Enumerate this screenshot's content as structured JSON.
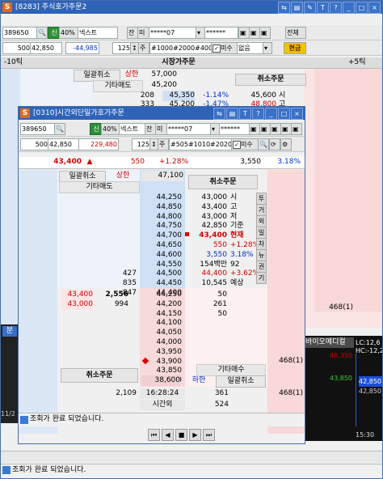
{
  "back_window": {
    "title": "[8283] 주식호가주문2",
    "toolbar": {
      "code": "389650",
      "btn_sin": "신",
      "pct": "40%",
      "name": "넥스트",
      "btn_jan": "잔",
      "btn_mi": "미",
      "account": "*****07",
      "password": "******",
      "btn_all": "전체",
      "btn_cash": "현금"
    },
    "row2": {
      "price": "500",
      "current": "42,850",
      "change": "-44,985",
      "qty": "125",
      "btn_ju": "주",
      "lots": "#1000#2000#4000",
      "misu": "미수",
      "credit": "없음"
    },
    "header": {
      "left": "-10틱",
      "mid": "시장가주문",
      "right": "+5틱"
    },
    "rows": {
      "cancel_all": "일괄취소",
      "upper": "상한",
      "upper_price": "57,000",
      "other_sell": "기타매도",
      "p1": "45,200",
      "cancel_order": "취소주문",
      "q1": "208",
      "p2": "45,350",
      "r1": "-1.14%",
      "m1": "45,600",
      "m1s": "시",
      "q2": "333",
      "p3": "45,200",
      "r2": "-1.47%",
      "m2": "48,800",
      "m2s": "고"
    },
    "right_side": {
      "qty_468": "468(1)",
      "stock_name": "바이오메디컬",
      "lc": "LC:12,6",
      "hc": "HC:-12,2",
      "v1": "48,350",
      "v2": "43,850",
      "v3": "42,850",
      "v4": "42,850",
      "time": "15:30",
      "status": "조회가 완료 되었습니다.",
      "tab_minute": "분",
      "date": "11/2"
    }
  },
  "front_window": {
    "title": "[0310]시간외단일가호가주문",
    "toolbar": {
      "code": "389650",
      "btn_sin": "신",
      "pct": "40%",
      "name": "넥스트",
      "btn_jan": "잔",
      "btn_mi": "미",
      "account": "*****07",
      "password": "******"
    },
    "row2": {
      "price": "500",
      "current": "42,850",
      "change": "229,480",
      "qty": "125",
      "btn_ju": "주",
      "lots": "#505#1010#2020",
      "misu": "미수"
    },
    "price_bar": {
      "price": "43,400",
      "arrow": "▲",
      "diff": "550",
      "rate": "+1.28%",
      "vol": "3,550",
      "vol_rate": "3.18%"
    },
    "header": {
      "cancel_all": "일괄취소",
      "upper": "상한",
      "upper_price": "47,100",
      "other_sell": "기타매도",
      "cancel_order": "취소주문"
    },
    "ask_prices": [
      "44,250",
      "44,850",
      "44,800",
      "44,750",
      "44,700",
      "44,650",
      "44,600",
      "44,550",
      "44,500",
      "44,450",
      "44,400"
    ],
    "ask_qty": [
      "",
      "",
      "",
      "",
      "",
      "",
      "",
      "",
      "427",
      "835",
      "847"
    ],
    "info_panel": [
      {
        "v": "43,000",
        "k": "시"
      },
      {
        "v": "43,400",
        "k": "고"
      },
      {
        "v": "43,000",
        "k": "저"
      },
      {
        "v": "42,850",
        "k": "기준"
      },
      {
        "v": "43,400",
        "k": "현재"
      },
      {
        "v": "550",
        "k": "+1.28%"
      },
      {
        "v": "3,550",
        "k": "3.18%"
      },
      {
        "v": "154백만",
        "k": "92"
      },
      {
        "v": "44,400",
        "k": "+3.62%"
      },
      {
        "v": "10,545",
        "k": "예상"
      }
    ],
    "vtabs": [
      "투",
      "거",
      "외",
      "일",
      "차",
      "뉴",
      "권",
      "기"
    ],
    "orders": [
      {
        "p": "43,400",
        "q": "2,556"
      },
      {
        "p": "43,000",
        "q": "994"
      }
    ],
    "bid_prices": [
      "44,250",
      "44,200",
      "44,150",
      "44,100",
      "44,050",
      "44,000",
      "43,950",
      "43,900",
      "43,850",
      "43,800"
    ],
    "bid_qty": [
      "50",
      "261",
      "50",
      "",
      "",
      "",
      "",
      "",
      "",
      ""
    ],
    "bid_total": "468(1)",
    "footer": {
      "lower_price": "38,600",
      "lower": "하한",
      "other_buy": "기타매수",
      "cancel_all2": "일괄취소",
      "cancel_order2": "취소주문",
      "total_sell": "2,109",
      "time": "16:28:24",
      "total_buy": "361",
      "total_right": "468(1)",
      "after_hours": "시간외",
      "after_val": "524"
    },
    "status": "조회가 완료 되었습니다."
  },
  "bottom_status": "조회가 완료 되었습니다."
}
